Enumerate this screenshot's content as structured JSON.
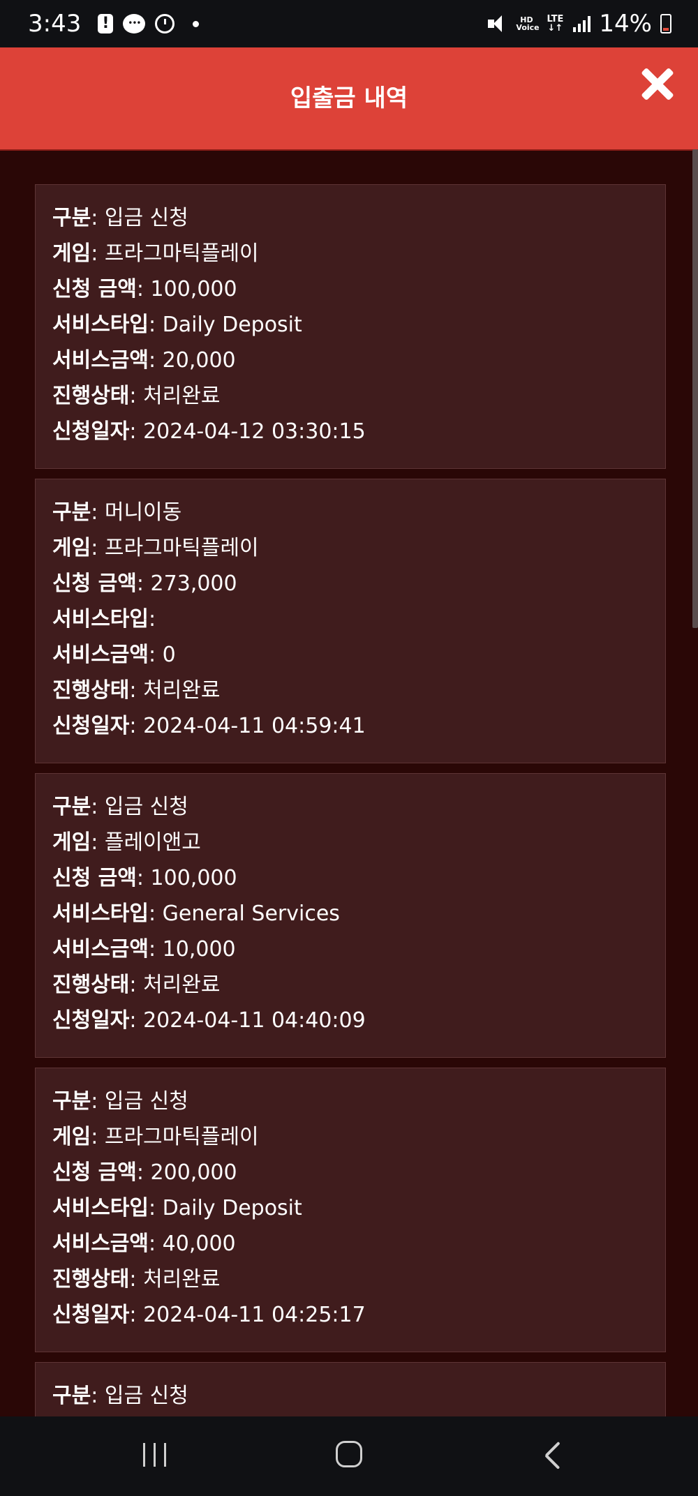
{
  "status_bar": {
    "time": "3:43",
    "icons": [
      "alert-icon",
      "chat-icon",
      "alarm-icon",
      "dot-icon",
      "mute-icon",
      "hd-voice-icon",
      "lte-icon",
      "signal-icon",
      "battery-icon"
    ],
    "hd_top": "HD",
    "hd_bottom": "Voice",
    "lte_top": "LTE",
    "lte_bottom": "↓↑",
    "battery": "14%"
  },
  "header": {
    "title": "입출금 내역",
    "background": "#dd4238"
  },
  "labels": {
    "type": "구분",
    "game": "게임",
    "amount": "신청 금액",
    "service_type": "서비스타입",
    "service_amount": "서비스금액",
    "status": "진행상태",
    "date": "신청일자"
  },
  "records": [
    {
      "type": "입금 신청",
      "game": "프라그마틱플레이",
      "amount": "100,000",
      "service_type": "Daily Deposit",
      "service_amount": "20,000",
      "status": "처리완료",
      "date": "2024-04-12 03:30:15"
    },
    {
      "type": "머니이동",
      "game": "프라그마틱플레이",
      "amount": "273,000",
      "service_type": "",
      "service_amount": "0",
      "status": "처리완료",
      "date": "2024-04-11 04:59:41"
    },
    {
      "type": "입금 신청",
      "game": "플레이앤고",
      "amount": "100,000",
      "service_type": "General Services",
      "service_amount": "10,000",
      "status": "처리완료",
      "date": "2024-04-11 04:40:09"
    },
    {
      "type": "입금 신청",
      "game": "프라그마틱플레이",
      "amount": "200,000",
      "service_type": "Daily Deposit",
      "service_amount": "40,000",
      "status": "처리완료",
      "date": "2024-04-11 04:25:17"
    },
    {
      "type": "입금 신청"
    }
  ],
  "colors": {
    "page_bg": "#2a0706",
    "card_bg": "#401c1d",
    "card_border": "#5e3435"
  }
}
